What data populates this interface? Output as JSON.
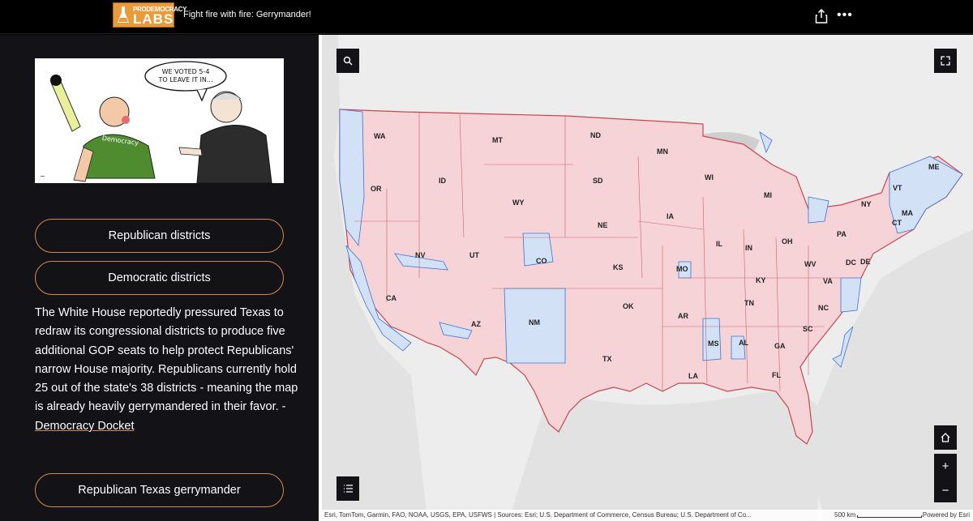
{
  "header": {
    "logo_small": "PRODEMOCRACY",
    "logo_big": "LABS",
    "title": "Fight fire with fire: Gerrymander!"
  },
  "cartoon": {
    "speech": [
      "WE VOTED 5-4",
      "TO LEAVE IT IN..."
    ],
    "shirt": "Democracy"
  },
  "sidebar": {
    "buttons": [
      "Republican districts",
      "Democratic districts",
      "Republican Texas gerrymander"
    ],
    "body_text": "The White House reportedly pressured Texas to redraw its congressional districts to produce five additional GOP seats to help protect Republicans' narrow House majority. Republicans currently hold 25 out of the state's 38 districts - meaning the map is already heavily gerrymandered in their favor. - ",
    "link_text": "Democracy Docket",
    "accent_color": "#d7894a"
  },
  "map": {
    "states": [
      "WA",
      "OR",
      "CA",
      "NV",
      "ID",
      "MT",
      "WY",
      "UT",
      "AZ",
      "CO",
      "NM",
      "ND",
      "SD",
      "NE",
      "KS",
      "OK",
      "TX",
      "MN",
      "IA",
      "MO",
      "AR",
      "LA",
      "WI",
      "IL",
      "MS",
      "AL",
      "TN",
      "KY",
      "IN",
      "MI",
      "OH",
      "GA",
      "FL",
      "SC",
      "NC",
      "VA",
      "WV",
      "PA",
      "NY",
      "VT",
      "ME",
      "MA",
      "CT",
      "DC",
      "DE"
    ],
    "republican_color": "#f5d3d6",
    "democratic_color": "#d3e1f7",
    "attribution": "Esri, TomTom, Garmin, FAO, NOAA, USGS, EPA, USFWS | Sources: Esri; U.S. Department of Commerce, Census Bureau; U.S. Department of Co...",
    "scale_label": "500 km",
    "powered_by": "Powered by Esri",
    "zoom_in": "+",
    "zoom_out": "−"
  }
}
